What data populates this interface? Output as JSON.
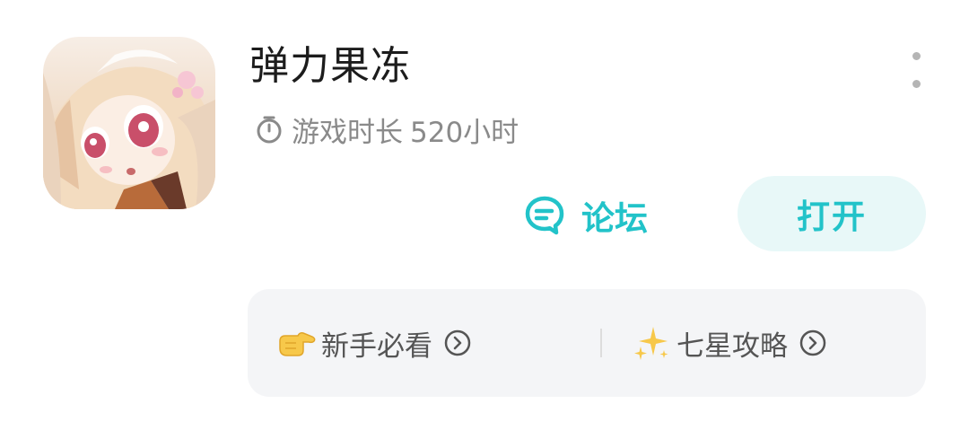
{
  "app": {
    "name": "弹力果冻",
    "playtime_label": "游戏时长",
    "playtime_value": "520小时",
    "icon": "app-icon-anime-girl",
    "more_icon": "more-vertical-icon"
  },
  "actions": {
    "forum_label": "论坛",
    "forum_icon": "chat-bubble-icon",
    "open_label": "打开"
  },
  "quick_links": [
    {
      "emoji": "👉",
      "emoji_icon": "pointing-hand-icon",
      "label": "新手必看"
    },
    {
      "emoji": "✨",
      "emoji_icon": "sparkles-icon",
      "label": "七星攻略"
    }
  ],
  "colors": {
    "accent": "#22c3c9",
    "open_bg": "#e8f8f8",
    "secondary_text": "#8a8a8a",
    "panel_bg": "#f4f5f7"
  }
}
